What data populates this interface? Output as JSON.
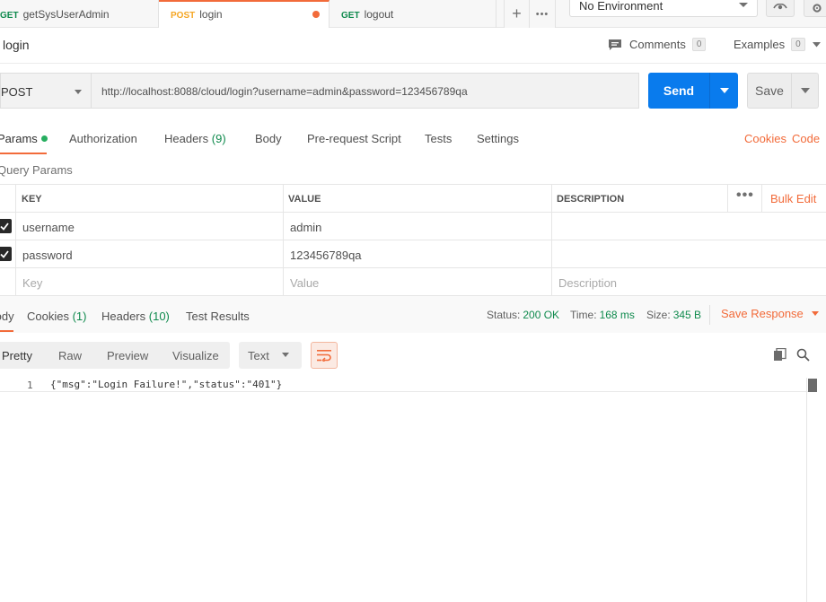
{
  "tabs": [
    {
      "method": "GET",
      "name": "getSysUserAdmin",
      "active": false
    },
    {
      "method": "POST",
      "name": "login",
      "active": true,
      "unsaved": true
    },
    {
      "method": "GET",
      "name": "logout",
      "active": false
    }
  ],
  "tab_actions": {
    "add": "+",
    "more": "•••"
  },
  "environment": {
    "selected": "No Environment"
  },
  "request": {
    "name": "login",
    "comments_label": "Comments",
    "comments_count": "0",
    "examples_label": "Examples",
    "examples_count": "0",
    "method": "POST",
    "url": "http://localhost:8088/cloud/login?username=admin&password=123456789qa",
    "send_label": "Send",
    "save_label": "Save"
  },
  "request_tabs": {
    "params": "Params",
    "authorization": "Authorization",
    "headers": "Headers",
    "headers_count": "(9)",
    "body": "Body",
    "prerequest": "Pre-request Script",
    "tests": "Tests",
    "settings": "Settings",
    "cookies_link": "Cookies",
    "code_link": "Code"
  },
  "query_params": {
    "title": "Query Params",
    "headers": {
      "key": "KEY",
      "value": "VALUE",
      "description": "DESCRIPTION",
      "bulk_edit": "Bulk Edit",
      "more": "•••"
    },
    "rows": [
      {
        "key": "username",
        "value": "admin",
        "description": "",
        "checked": true
      },
      {
        "key": "password",
        "value": "123456789qa",
        "description": "",
        "checked": true
      }
    ],
    "placeholders": {
      "key": "Key",
      "value": "Value",
      "description": "Description"
    }
  },
  "response": {
    "tabs": {
      "body": "Body",
      "cookies": "Cookies",
      "cookies_count": "(1)",
      "headers": "Headers",
      "headers_count": "(10)",
      "test_results": "Test Results"
    },
    "status_label": "Status:",
    "status_value": "200 OK",
    "time_label": "Time:",
    "time_value": "168 ms",
    "size_label": "Size:",
    "size_value": "345 B",
    "save_response": "Save Response",
    "view_options": [
      "Pretty",
      "Raw",
      "Preview",
      "Visualize"
    ],
    "format": "Text",
    "line_number": "1",
    "body_text": "{\"msg\":\"Login Failure!\",\"status\":\"401\"}"
  },
  "colors": {
    "accent": "#f26b3a",
    "send_blue": "#097bed",
    "success_green": "#0f8a4d"
  }
}
